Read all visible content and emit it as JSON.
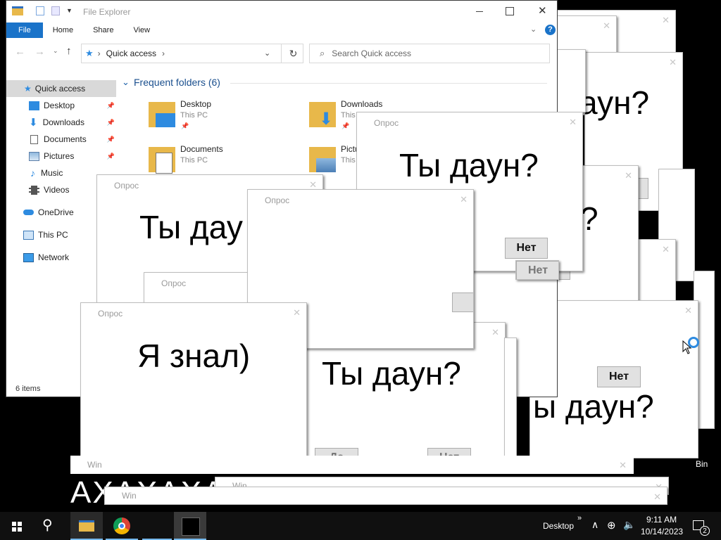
{
  "explorer": {
    "title": "File Explorer",
    "ribbon_tabs": [
      "File",
      "Home",
      "Share",
      "View"
    ],
    "address": "Quick access",
    "search_placeholder": "Search Quick access",
    "section_header": "Frequent folders (6)",
    "sidebar": [
      {
        "label": "Quick access",
        "icon": "star-icon"
      },
      {
        "label": "Desktop",
        "icon": "desktop-icon",
        "pinned": true
      },
      {
        "label": "Downloads",
        "icon": "download-icon",
        "pinned": true
      },
      {
        "label": "Documents",
        "icon": "document-icon",
        "pinned": true
      },
      {
        "label": "Pictures",
        "icon": "pictures-icon",
        "pinned": true
      },
      {
        "label": "Music",
        "icon": "music-icon"
      },
      {
        "label": "Videos",
        "icon": "video-icon"
      },
      {
        "label": "OneDrive",
        "icon": "cloud-icon"
      },
      {
        "label": "This PC",
        "icon": "computer-icon"
      },
      {
        "label": "Network",
        "icon": "network-icon"
      }
    ],
    "folders": [
      {
        "name": "Desktop",
        "location": "This PC"
      },
      {
        "name": "Downloads",
        "location": "This PC"
      },
      {
        "name": "Documents",
        "location": "This PC"
      },
      {
        "name": "Pictu",
        "location": "This"
      }
    ],
    "status": "6 items"
  },
  "dialogs": {
    "title": "Опрос",
    "question": "Ты даун?",
    "question_partial_left": "Ты дау",
    "question_partial_top": "аун?",
    "question_partial_mid": "?",
    "question_partial_right": "ы даун?",
    "answer": "Я знал)",
    "no_label": "Нет",
    "yes_partial": "Да",
    "win_title": "Win",
    "laugh_text": "АХАХАХАХАХАХАХАХАХАХАХАХАХАХАХАХ"
  },
  "desktop": {
    "recycle_partial": "Bin"
  },
  "taskbar": {
    "desktop_label": "Desktop",
    "time": "9:11 AM",
    "date": "10/14/2023",
    "notification_count": "2"
  },
  "colors": {
    "accent": "#1a73c9",
    "taskbar": "#101010"
  }
}
